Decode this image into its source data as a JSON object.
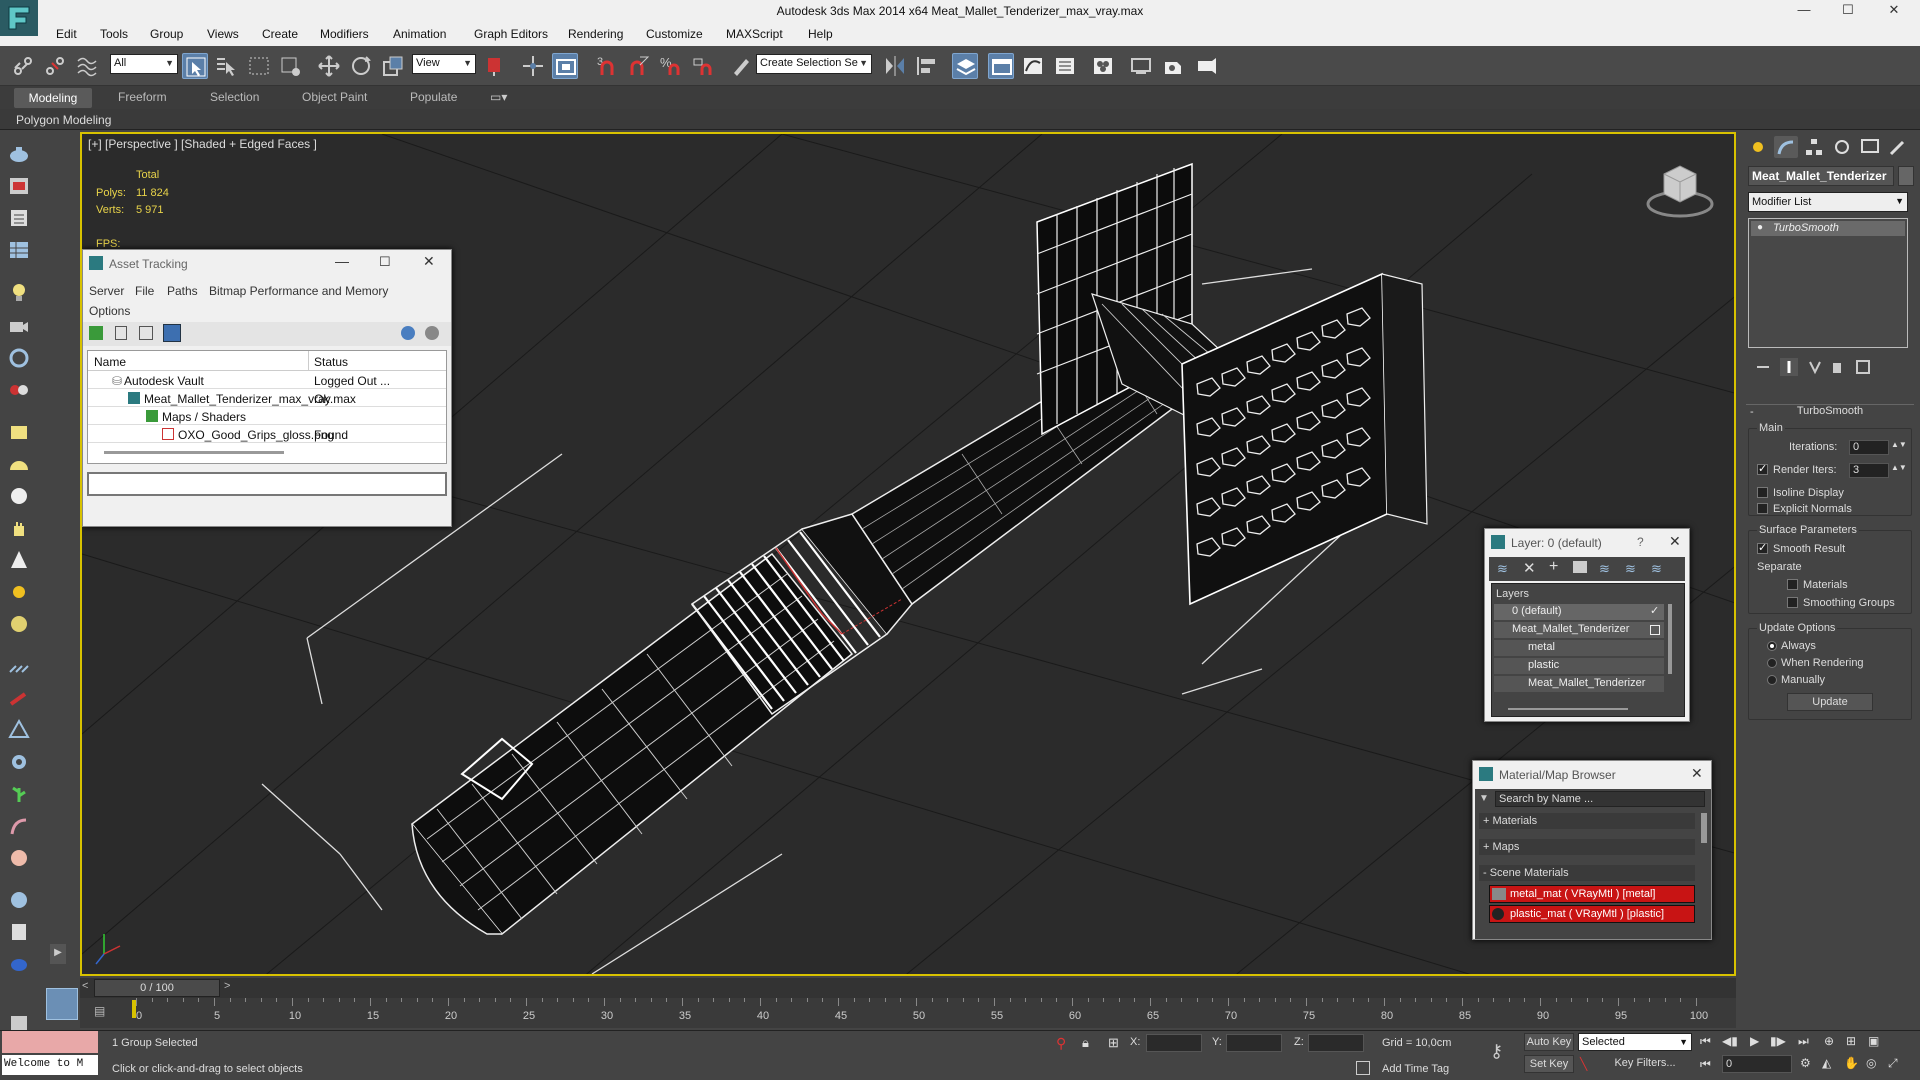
{
  "window": {
    "title": "Autodesk 3ds Max  2014 x64    Meat_Mallet_Tenderizer_max_vray.max",
    "controls": [
      "—",
      "☐",
      "✕"
    ]
  },
  "menu": [
    "Edit",
    "Tools",
    "Group",
    "Views",
    "Create",
    "Modifiers",
    "Animation",
    "Graph Editors",
    "Rendering",
    "Customize",
    "MAXScript",
    "Help"
  ],
  "toolbar": {
    "selection_filter": "All",
    "ref_coord": "View",
    "named_selection": "Create Selection Se"
  },
  "ribbon": {
    "tabs": [
      "Modeling",
      "Freeform",
      "Selection",
      "Object Paint",
      "Populate"
    ],
    "panel": "Polygon Modeling"
  },
  "viewport": {
    "label": "[+] [Perspective ] [Shaded + Edged Faces ]",
    "stats_header": "Total",
    "polys_label": "Polys:",
    "polys_value": "11 824",
    "verts_label": "Verts:",
    "verts_value": "5 971",
    "fps_label": "FPS:"
  },
  "asset_tracking": {
    "title": "Asset Tracking",
    "menu": [
      "Server",
      "File",
      "Paths",
      "Bitmap Performance and Memory",
      "Options"
    ],
    "col_name": "Name",
    "col_status": "Status",
    "rows": [
      {
        "name": "Autodesk Vault",
        "status": "Logged Out ..."
      },
      {
        "name": "Meat_Mallet_Tenderizer_max_vray.max",
        "status": "Ok"
      },
      {
        "name": "Maps / Shaders",
        "status": ""
      },
      {
        "name": "OXO_Good_Grips_gloss.png",
        "status": "Found"
      }
    ]
  },
  "layer_dialog": {
    "title": "Layer: 0 (default)",
    "help": "?",
    "header": "Layers",
    "items": [
      "0 (default)",
      "Meat_Mallet_Tenderizer",
      "metal",
      "plastic",
      "Meat_Mallet_Tenderizer"
    ]
  },
  "material_browser": {
    "title": "Material/Map Browser",
    "search_placeholder": "Search by Name ...",
    "sections": [
      "+ Materials",
      "+ Maps",
      "- Scene Materials"
    ],
    "materials": [
      "metal_mat  ( VRayMtl )  [metal]",
      "plastic_mat  ( VRayMtl )  [plastic]"
    ],
    "accent": "#c81414"
  },
  "command_panel": {
    "object_name": "Meat_Mallet_Tenderizer",
    "modifier_list": "Modifier List",
    "stack_item": "TurboSmooth",
    "rollout": "TurboSmooth",
    "main_group": "Main",
    "iterations_label": "Iterations:",
    "iterations_value": "0",
    "render_iters_label": "Render Iters:",
    "render_iters_value": "3",
    "isoline": "Isoline Display",
    "explicit_normals": "Explicit Normals",
    "surface_group": "Surface Parameters",
    "smooth_result": "Smooth Result",
    "separate": "Separate",
    "materials": "Materials",
    "smoothing_groups": "Smoothing Groups",
    "update_group": "Update Options",
    "always": "Always",
    "when_rendering": "When Rendering",
    "manually": "Manually",
    "update_button": "Update"
  },
  "timeline": {
    "frame_display": "0 / 100",
    "ticks": [
      "0",
      "5",
      "10",
      "15",
      "20",
      "25",
      "30",
      "35",
      "40",
      "45",
      "50",
      "55",
      "60",
      "65",
      "70",
      "75",
      "80",
      "85",
      "90",
      "95",
      "100"
    ]
  },
  "status": {
    "maxscript": "Welcome to M",
    "selection": "1 Group Selected",
    "prompt": "Click or click-and-drag to select objects",
    "x_label": "X:",
    "y_label": "Y:",
    "z_label": "Z:",
    "grid": "Grid = 10,0cm",
    "add_time_tag": "Add Time Tag",
    "auto_key": "Auto Key",
    "set_key": "Set Key",
    "selected": "Selected",
    "key_filters": "Key Filters...",
    "frame": "0"
  }
}
